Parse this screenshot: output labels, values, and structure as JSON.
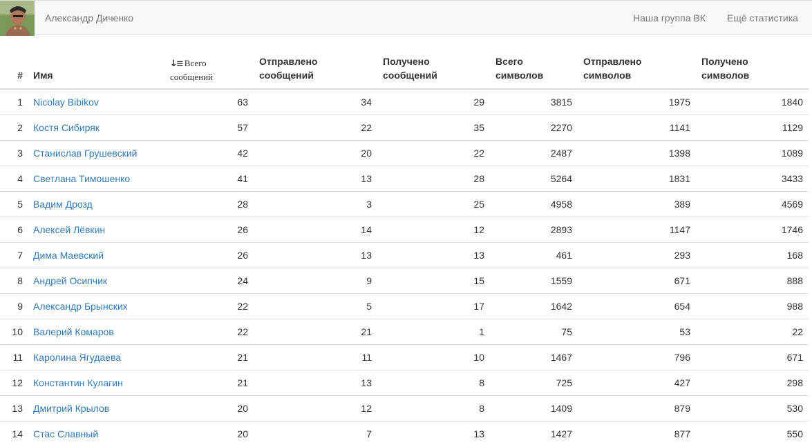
{
  "navbar": {
    "user_name": "Александр Диченко",
    "links": [
      "Наша группа ВК",
      "Ещё статистика"
    ]
  },
  "table": {
    "headers": {
      "index": "#",
      "name": "Имя",
      "total_messages": [
        "Всего",
        "сообщений"
      ],
      "sent_messages": [
        "Отправлено",
        "сообщений"
      ],
      "received_messages": [
        "Получено",
        "сообщений"
      ],
      "total_chars": [
        "Всего",
        "символов"
      ],
      "sent_chars": [
        "Отправлено",
        "символов"
      ],
      "received_chars": [
        "Получено",
        "символов"
      ]
    },
    "sort_icon": "sort-descending-icon",
    "rows": [
      {
        "index": "1",
        "name": "Nicolay Bibikov",
        "total": "63",
        "sent": "34",
        "received": "29",
        "chars_total": "3815",
        "chars_sent": "1975",
        "chars_received": "1840"
      },
      {
        "index": "2",
        "name": "Костя Сибиряк",
        "total": "57",
        "sent": "22",
        "received": "35",
        "chars_total": "2270",
        "chars_sent": "1141",
        "chars_received": "1129"
      },
      {
        "index": "3",
        "name": "Станислав Грушевский",
        "total": "42",
        "sent": "20",
        "received": "22",
        "chars_total": "2487",
        "chars_sent": "1398",
        "chars_received": "1089"
      },
      {
        "index": "4",
        "name": "Светлана Тимошенко",
        "total": "41",
        "sent": "13",
        "received": "28",
        "chars_total": "5264",
        "chars_sent": "1831",
        "chars_received": "3433"
      },
      {
        "index": "5",
        "name": "Вадим Дрозд",
        "total": "28",
        "sent": "3",
        "received": "25",
        "chars_total": "4958",
        "chars_sent": "389",
        "chars_received": "4569"
      },
      {
        "index": "6",
        "name": "Алексей Лёвкин",
        "total": "26",
        "sent": "14",
        "received": "12",
        "chars_total": "2893",
        "chars_sent": "1147",
        "chars_received": "1746"
      },
      {
        "index": "7",
        "name": "Дима Маевский",
        "total": "26",
        "sent": "13",
        "received": "13",
        "chars_total": "461",
        "chars_sent": "293",
        "chars_received": "168"
      },
      {
        "index": "8",
        "name": "Андрей Осипчик",
        "total": "24",
        "sent": "9",
        "received": "15",
        "chars_total": "1559",
        "chars_sent": "671",
        "chars_received": "888"
      },
      {
        "index": "9",
        "name": "Александр Брынских",
        "total": "22",
        "sent": "5",
        "received": "17",
        "chars_total": "1642",
        "chars_sent": "654",
        "chars_received": "988"
      },
      {
        "index": "10",
        "name": "Валерий Комаров",
        "total": "22",
        "sent": "21",
        "received": "1",
        "chars_total": "75",
        "chars_sent": "53",
        "chars_received": "22"
      },
      {
        "index": "11",
        "name": "Каролина Ягудаева",
        "total": "21",
        "sent": "11",
        "received": "10",
        "chars_total": "1467",
        "chars_sent": "796",
        "chars_received": "671"
      },
      {
        "index": "12",
        "name": "Константин Кулагин",
        "total": "21",
        "sent": "13",
        "received": "8",
        "chars_total": "725",
        "chars_sent": "427",
        "chars_received": "298"
      },
      {
        "index": "13",
        "name": "Дмитрий Крылов",
        "total": "20",
        "sent": "12",
        "received": "8",
        "chars_total": "1409",
        "chars_sent": "879",
        "chars_received": "530"
      },
      {
        "index": "14",
        "name": "Стас Славный",
        "total": "20",
        "sent": "7",
        "received": "13",
        "chars_total": "1427",
        "chars_sent": "877",
        "chars_received": "550"
      }
    ]
  },
  "colors": {
    "link": "#337ab7",
    "navbar_bg": "#f8f8f8",
    "navbar_text": "#777777",
    "border": "#dddddd"
  }
}
